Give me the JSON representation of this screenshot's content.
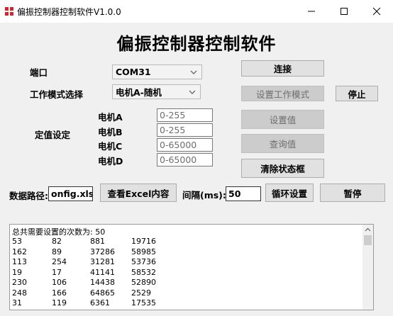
{
  "window": {
    "title": "偏振控制器控制软件V1.0.0",
    "controls": {
      "minimize": "—",
      "maximize": "☐",
      "close": "✕"
    }
  },
  "header": {
    "title": "偏振控制器控制软件"
  },
  "port": {
    "label": "端口",
    "value": "COM31"
  },
  "mode": {
    "label": "工作模式选择",
    "value": "电机A-随机"
  },
  "setpoint": {
    "group_label": "定值设定",
    "motors": [
      {
        "label": "电机A",
        "placeholder": "0-255"
      },
      {
        "label": "电机B",
        "placeholder": "0-255"
      },
      {
        "label": "电机C",
        "placeholder": "0-65000"
      },
      {
        "label": "电机D",
        "placeholder": "0-65000"
      }
    ]
  },
  "buttons": {
    "connect": "连接",
    "set_mode": "设置工作模式",
    "stop": "停止",
    "set_value": "设置值",
    "query_value": "查询值",
    "clear_status": "清除状态框",
    "view_excel": "查看Excel内容",
    "loop_set": "循环设置",
    "pause": "暂停"
  },
  "data_path": {
    "label": "数据路径:",
    "value": "onfig.xlsx"
  },
  "interval": {
    "label": "间隔(ms):",
    "value": "50"
  },
  "log": {
    "header": "总共需要设置的次数为: 50",
    "rows": [
      [
        "53",
        "82",
        "881",
        "19716"
      ],
      [
        "162",
        "89",
        "37286",
        "58985"
      ],
      [
        "113",
        "254",
        "31281",
        "53736"
      ],
      [
        "19",
        "17",
        "41141",
        "58532"
      ],
      [
        "230",
        "106",
        "14438",
        "52890"
      ],
      [
        "248",
        "166",
        "64865",
        "2529"
      ],
      [
        "31",
        "119",
        "6361",
        "17535"
      ]
    ]
  },
  "colors": {
    "window_bg": "#f0f0f0",
    "button_bg": "#e1e1e1",
    "disabled_bg": "#cccccc",
    "icon_red": "#d9232a"
  }
}
